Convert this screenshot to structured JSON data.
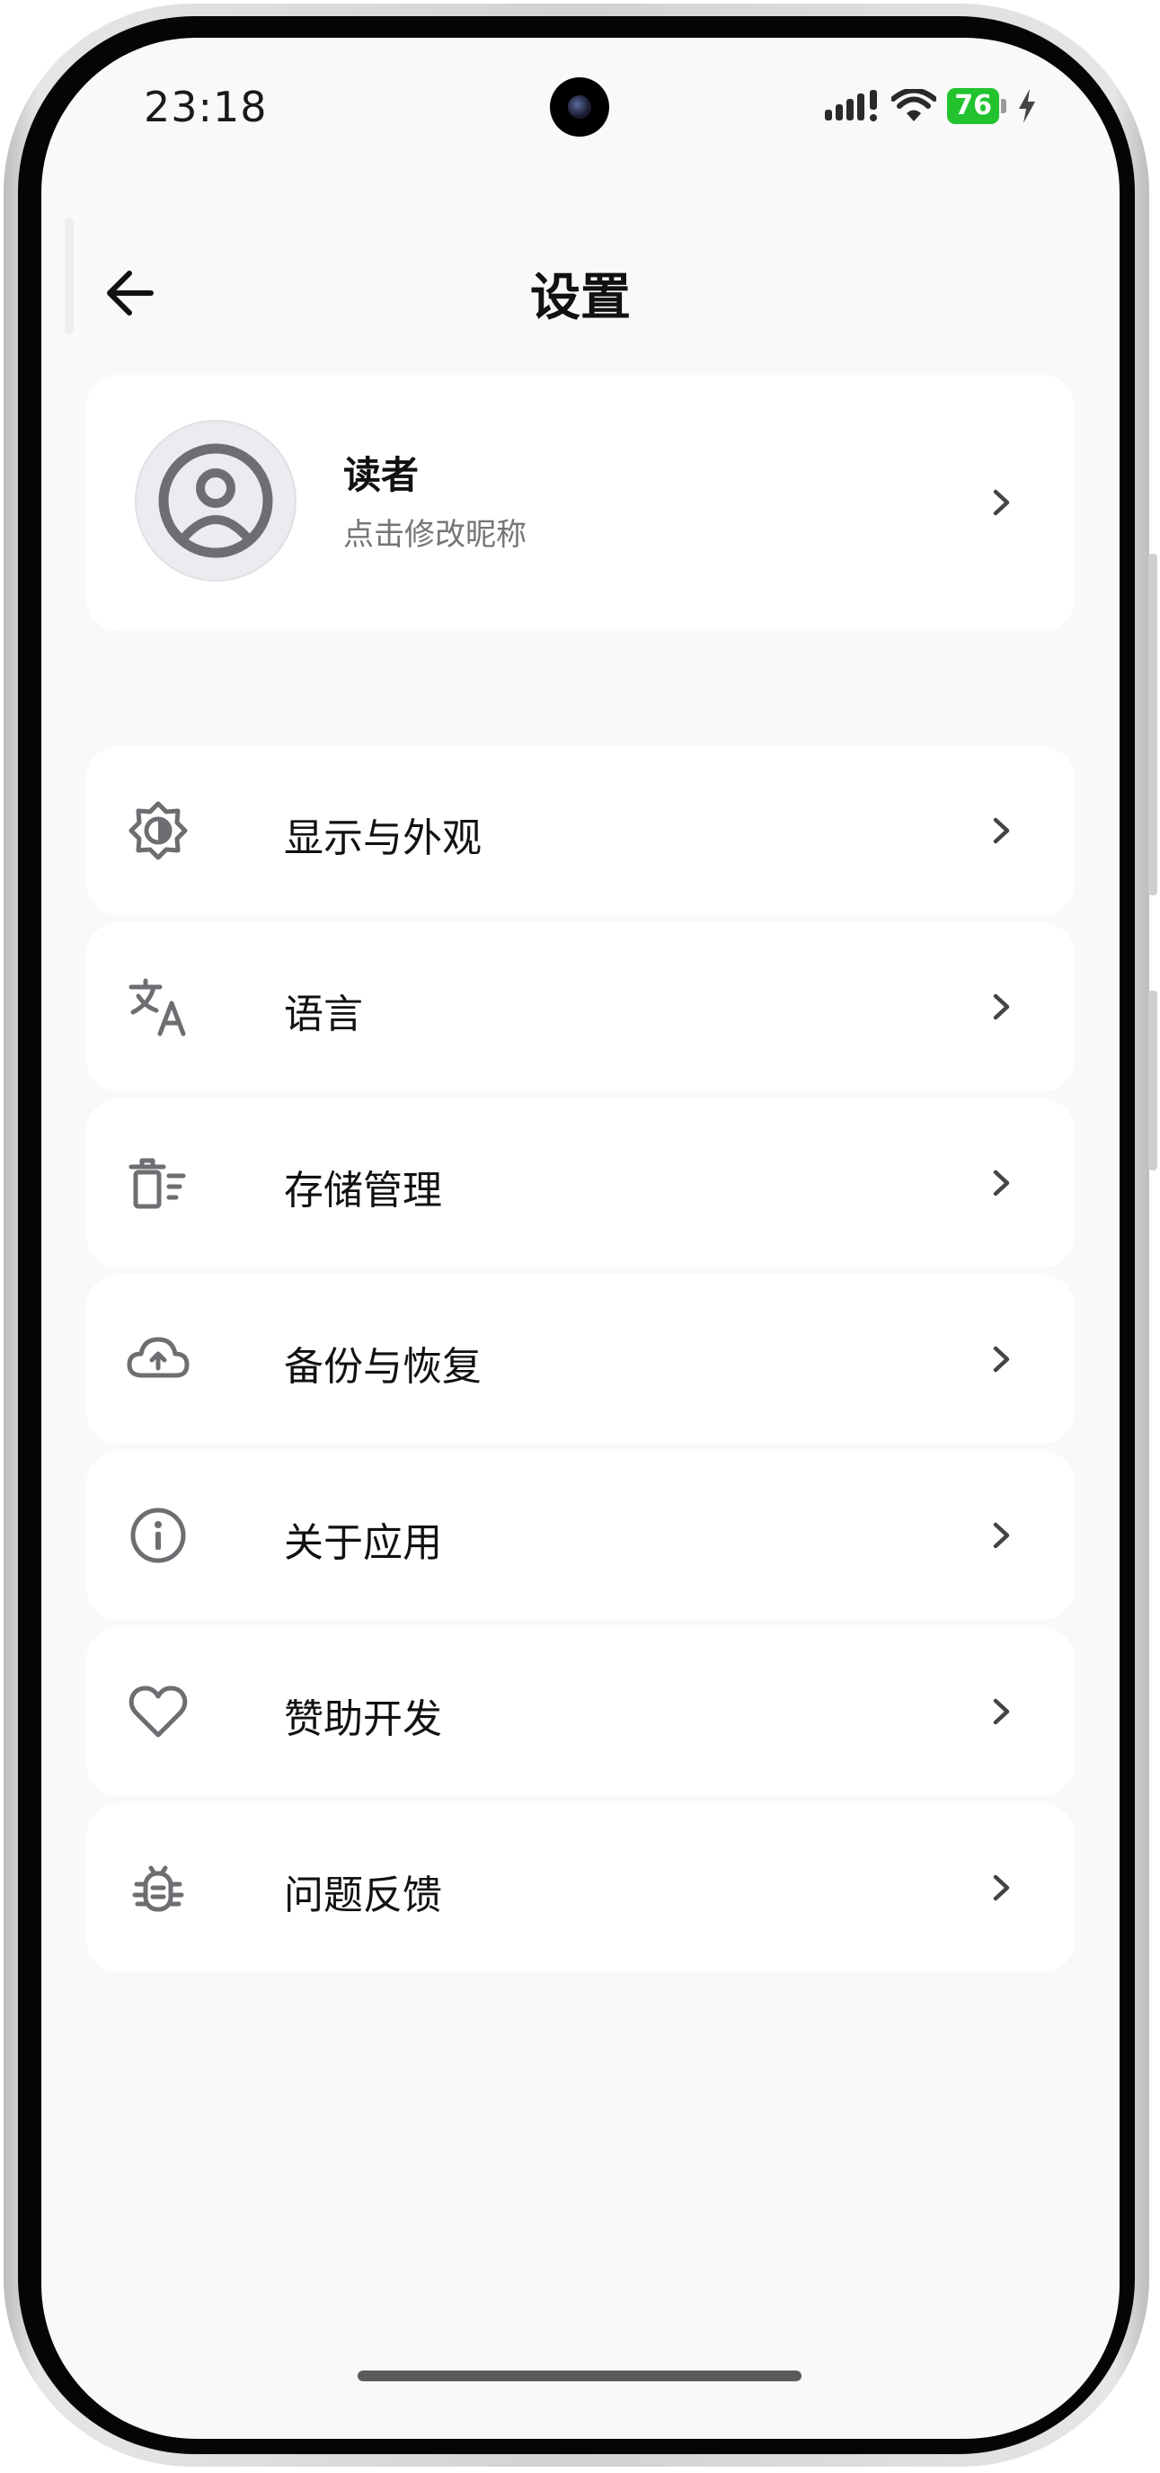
{
  "status_bar": {
    "time": "23:18",
    "battery_level": "76",
    "signal_icon": "signal-bars-icon",
    "wifi_icon": "wifi-icon",
    "charging_icon": "lightning-bolt-icon",
    "battery_color": "#22c32e"
  },
  "header": {
    "title": "设置",
    "back_icon": "arrow-left-icon"
  },
  "profile": {
    "name": "读者",
    "subtitle": "点击修改昵称",
    "avatar_icon": "user-circle-icon"
  },
  "menu": {
    "items": [
      {
        "label": "显示与外观",
        "icon": "brightness-contrast-icon"
      },
      {
        "label": "语言",
        "icon": "translate-icon"
      },
      {
        "label": "存储管理",
        "icon": "trash-list-icon"
      },
      {
        "label": "备份与恢复",
        "icon": "cloud-upload-icon"
      },
      {
        "label": "关于应用",
        "icon": "info-circle-icon"
      },
      {
        "label": "赞助开发",
        "icon": "heart-icon"
      },
      {
        "label": "问题反馈",
        "icon": "bug-icon"
      }
    ]
  },
  "colors": {
    "background": "#f9f9f9",
    "card": "#ffffff",
    "icon_gray": "#6e6e72",
    "text_primary": "#111111",
    "text_secondary": "#757575"
  }
}
